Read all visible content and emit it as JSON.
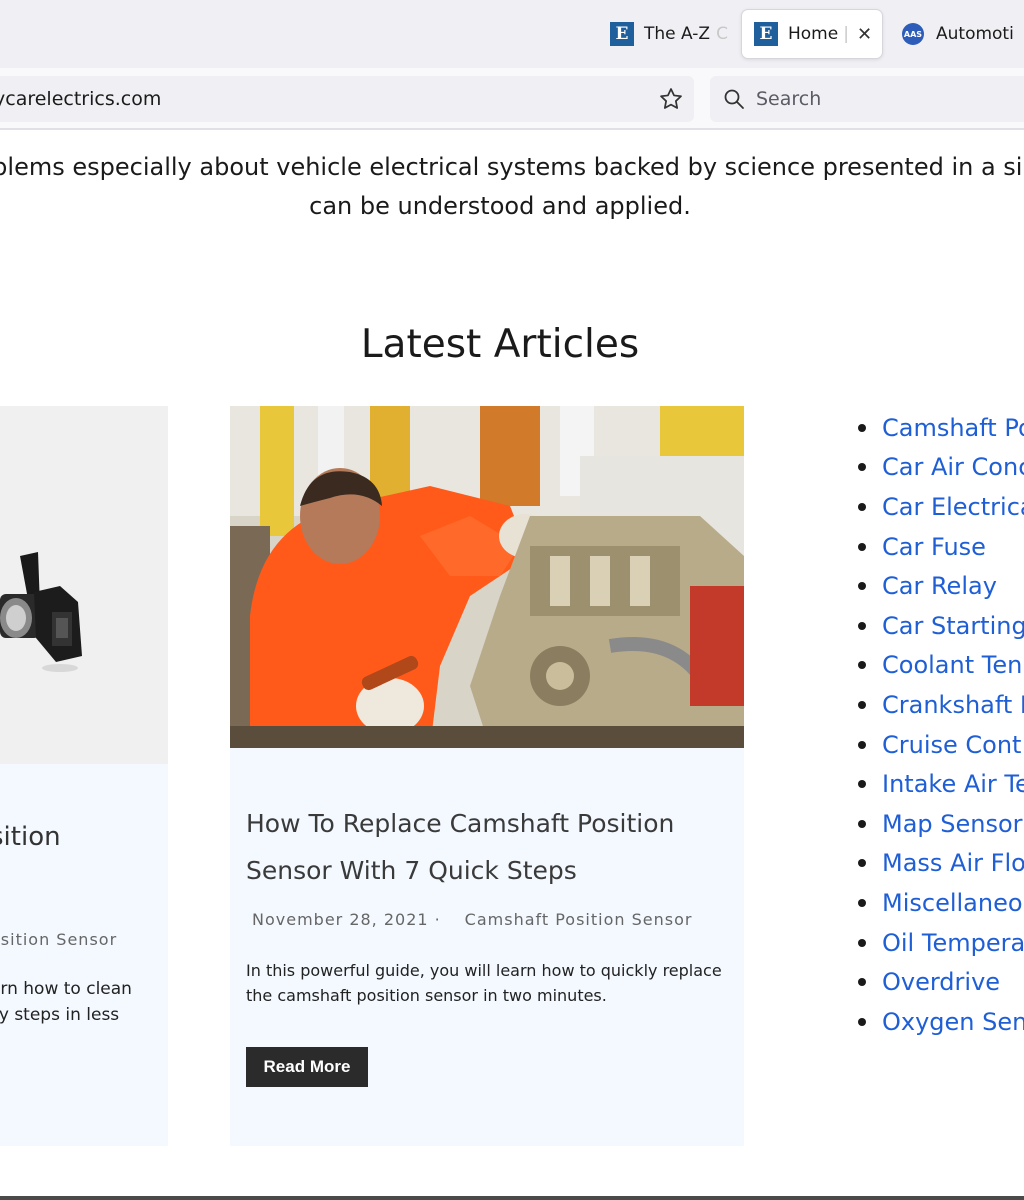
{
  "browser": {
    "tabs": [
      {
        "label": "The A-Z",
        "faded": "C",
        "favicon": "E"
      },
      {
        "label": "Home",
        "faded": "|",
        "favicon": "E",
        "active": true
      },
      {
        "label": "Automoti",
        "faded": "",
        "favicon": "AAS"
      }
    ],
    "url": "ycarelectrics.com",
    "search_placeholder": "Search"
  },
  "page": {
    "intro_line1": "oblems especially about vehicle electrical systems backed by science presented in a si",
    "intro_line2": "can be understood and applied.",
    "section_title": "Latest Articles"
  },
  "articles": {
    "left": {
      "title": "sition",
      "category": "osition Sensor",
      "excerpt_line1": "arn how to clean",
      "excerpt_line2": "sy steps in less"
    },
    "main": {
      "title": "How To Replace Camshaft Position Sensor With 7 Quick Steps",
      "date": "November 28, 2021",
      "separator": "·",
      "category": "Camshaft Position Sensor",
      "excerpt": "In this powerful guide, you will learn how to quickly replace the camshaft position sensor in two minutes.",
      "button_label": "Read More"
    }
  },
  "categories": [
    "Camshaft Po",
    "Car Air Conc",
    "Car Electrica",
    "Car Fuse",
    "Car Relay",
    "Car Starting",
    "Coolant Ten",
    "Crankshaft I",
    "Cruise Cont",
    "Intake Air Te",
    "Map Sensor",
    "Mass Air Flo",
    "Miscellaneo",
    "Oil Tempera",
    "Overdrive",
    "Oxygen Sen"
  ],
  "colors": {
    "link": "#1f5fd6",
    "card_bg": "#f3f9fe",
    "button_bg": "#2b2b2b",
    "favicon_blue": "#1f5f9c"
  }
}
